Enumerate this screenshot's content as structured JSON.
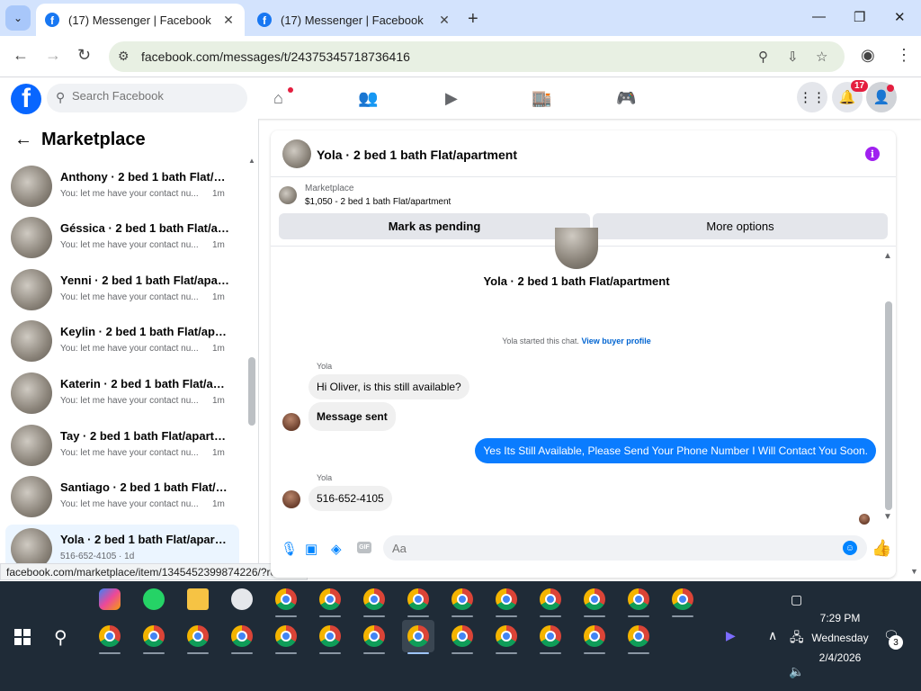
{
  "browser": {
    "tabs": [
      {
        "title": "(17) Messenger | Facebook",
        "active": true
      },
      {
        "title": "(17) Messenger | Facebook",
        "active": false
      }
    ],
    "url": "facebook.com/messages/t/24375345718736416",
    "status_url": "facebook.com/marketplace/item/1345452399874226/?referr..."
  },
  "facebook": {
    "search_placeholder": "Search Facebook",
    "notifications_count": "17"
  },
  "sidebar": {
    "title": "Marketplace",
    "conversations": [
      {
        "name": "Anthony · 2 bed 1 bath Flat/apa...",
        "preview": "You: let me have your contact nu...",
        "time": "1m"
      },
      {
        "name": "Géssica · 2 bed 1 bath Flat/apart...",
        "preview": "You: let me have your contact nu...",
        "time": "1m"
      },
      {
        "name": "Yenni · 2 bed 1 bath Flat/apartm...",
        "preview": "You: let me have your contact nu...",
        "time": "1m"
      },
      {
        "name": "Keylin · 2 bed 1 bath Flat/apart...",
        "preview": "You: let me have your contact nu...",
        "time": "1m"
      },
      {
        "name": "Katerin · 2 bed 1 bath Flat/apart...",
        "preview": "You: let me have your contact nu...",
        "time": "1m"
      },
      {
        "name": "Tay · 2 bed 1 bath Flat/apartment",
        "preview": "You: let me have your contact nu...",
        "time": "1m"
      },
      {
        "name": "Santiago · 2 bed 1 bath Flat/apa...",
        "preview": "You: let me have your contact nu...",
        "time": "1m"
      },
      {
        "name": "Yola · 2 bed 1 bath Flat/apartme...",
        "preview": "516-652-4105 · 1d",
        "time": ""
      }
    ]
  },
  "chat": {
    "title": "Yola · 2 bed 1 bath Flat/apartment",
    "marketplace_label": "Marketplace",
    "listing": "$1,050 - 2 bed 1 bath Flat/apartment",
    "mark_pending": "Mark as pending",
    "more_options": "More options",
    "header_name": "Yola · 2 bed 1 bath Flat/apartment",
    "started_text": "Yola started this chat.",
    "view_profile": "View buyer profile",
    "sender1": "Yola",
    "msg1": "Hi Oliver, is this still available?",
    "msg2": "Message sent",
    "msg3": "Yes Its Still Available, Please Send Your Phone Number I Will Contact You Soon.",
    "sender2": "Yola",
    "msg4": "516-652-4105",
    "composer_placeholder": "Aa"
  },
  "taskbar": {
    "time": "7:29 PM",
    "day": "Wednesday",
    "date": "2/4/2026",
    "notifications": "3"
  }
}
